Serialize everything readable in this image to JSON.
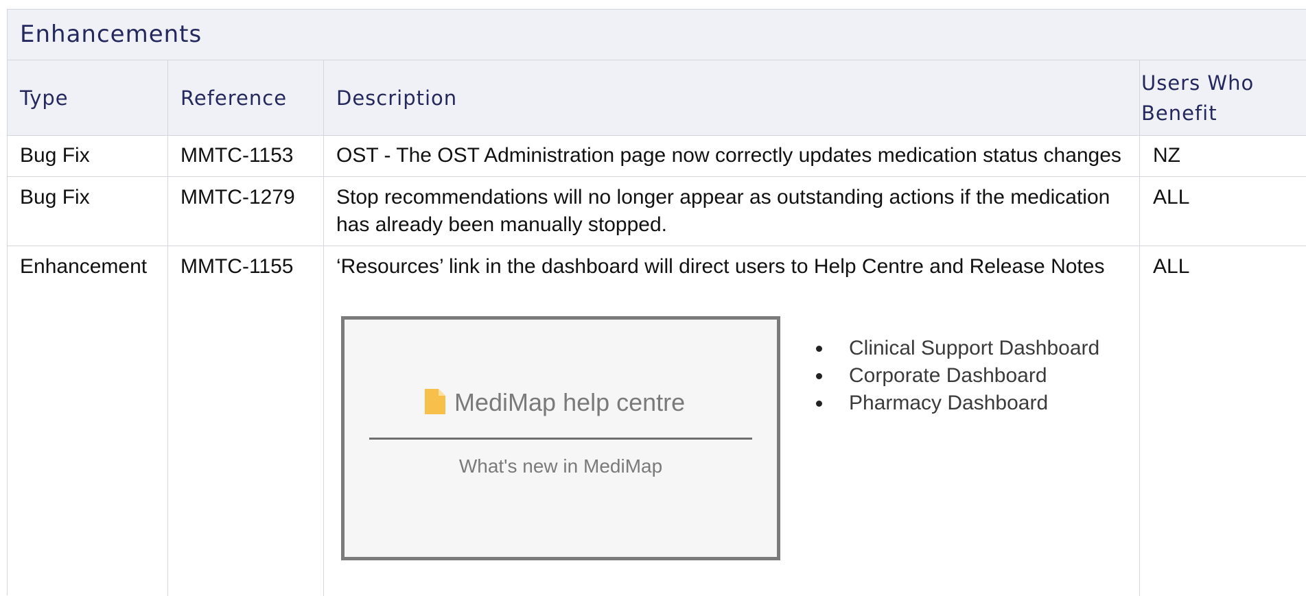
{
  "section": {
    "title": "Enhancements"
  },
  "table": {
    "headers": {
      "type": "Type",
      "reference": "Reference",
      "description": "Description",
      "users_line1": "Users Who",
      "users_line2": "Benefit"
    },
    "rows": [
      {
        "type": "Bug Fix",
        "reference": "MMTC-1153",
        "description": "OST - The OST Administration page now correctly updates medication status changes",
        "users": "NZ"
      },
      {
        "type": "Bug Fix",
        "reference": "MMTC-1279",
        "description": "Stop recommendations will no longer appear as outstanding actions if the medication has already been manually stopped.",
        "users": "ALL"
      },
      {
        "type": "Enhancement",
        "reference": "MMTC-1155",
        "description": "‘Resources’ link in the dashboard will direct users to Help Centre and Release Notes",
        "users": "ALL"
      }
    ]
  },
  "embedded_screenshot": {
    "icon": "document-icon",
    "icon_color": "#f7c04a",
    "title": "MediMap help centre",
    "subtitle": "What's new in MediMap"
  },
  "dashboards": [
    "Clinical Support Dashboard",
    "Corporate Dashboard",
    "Pharmacy Dashboard"
  ]
}
